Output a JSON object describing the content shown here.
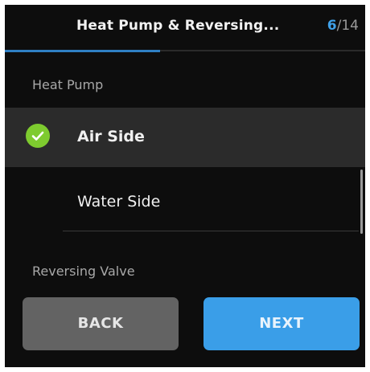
{
  "header": {
    "title": "Heat Pump & Reversing...",
    "step_current": "6",
    "step_separator": "/",
    "step_total": "14",
    "progress_fraction": 0.43
  },
  "sections": {
    "heat_pump_label": "Heat Pump",
    "reversing_valve_label": "Reversing Valve"
  },
  "options": [
    {
      "label": "Air Side",
      "selected": true
    },
    {
      "label": "Water Side",
      "selected": false
    }
  ],
  "icons": {
    "selected_check": "check-circle-icon"
  },
  "buttons": {
    "back_label": "BACK",
    "next_label": "NEXT"
  },
  "colors": {
    "background": "#0d0d0d",
    "accent_blue": "#3a9ee8",
    "check_green": "#7ecb2f",
    "selected_row": "#2b2b2b",
    "back_button": "#636363"
  }
}
